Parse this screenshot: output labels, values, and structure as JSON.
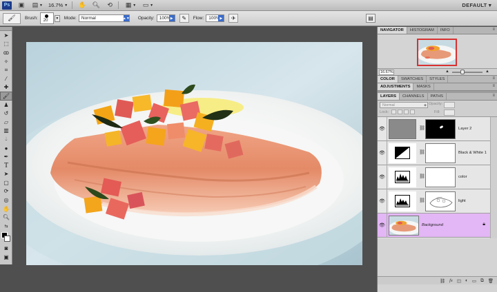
{
  "appbar": {
    "logo": "Ps",
    "zoom": "16.7%",
    "workspace": "DEFAULT"
  },
  "options": {
    "brush_label": "Brush:",
    "brush_size": "20",
    "mode_label": "Mode:",
    "mode_value": "Normal",
    "opacity_label": "Opacity:",
    "opacity_value": "100%",
    "flow_label": "Flow:",
    "flow_value": "100%"
  },
  "navigator": {
    "tabs": [
      "NAVIGATOR",
      "HISTOGRAM",
      "INFO"
    ],
    "zoom": "16.67%"
  },
  "color_panel": {
    "tabs": [
      "COLOR",
      "SWATCHES",
      "STYLES"
    ]
  },
  "adjust_panel": {
    "tabs": [
      "ADJUSTMENTS",
      "MASKS"
    ]
  },
  "layers_panel": {
    "tabs": [
      "LAYERS",
      "CHANNELS",
      "PATHS"
    ],
    "blend_mode": "Normal",
    "opacity_label": "Opacity:",
    "lock_label": "Lock:",
    "fill_label": "Fill:",
    "layers": [
      {
        "name": "Layer 2",
        "type": "gray-fill"
      },
      {
        "name": "Black & White 1",
        "type": "adjustment-bw"
      },
      {
        "name": "color",
        "type": "adjustment-levels"
      },
      {
        "name": "light",
        "type": "adjustment-levels-mask"
      },
      {
        "name": "Background",
        "type": "background",
        "selected": true
      }
    ]
  },
  "colors": {
    "layer_selected": "#e3b6f5",
    "nav_frame": "#d93030",
    "ps_blue": "#1d3b8a"
  }
}
